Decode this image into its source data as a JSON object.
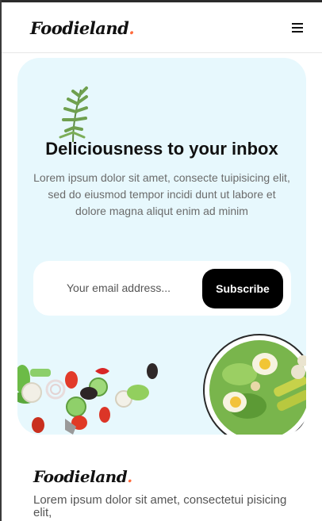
{
  "header": {
    "logo_text": "Foodieland",
    "logo_dot": ".",
    "menu_icon": "hamburger-menu-icon"
  },
  "newsletter": {
    "title": "Deliciousness to your inbox",
    "description": "Lorem ipsum dolor sit amet, consecte tuipisicing elit, sed do eiusmod tempor incidi dunt ut labore et dolore magna aliqut enim ad minim",
    "email_placeholder": "Your email address...",
    "subscribe_label": "Subscribe",
    "background_color": "#e7f8fd",
    "button_color": "#000000"
  },
  "footer": {
    "logo_text": "Foodieland",
    "logo_dot": ".",
    "tagline": "Lorem ipsum dolor sit amet, consectetui pisicing elit,"
  },
  "colors": {
    "accent_dot": "#ff6b3d",
    "text_primary": "#111111",
    "text_muted": "#6b6b6b"
  }
}
